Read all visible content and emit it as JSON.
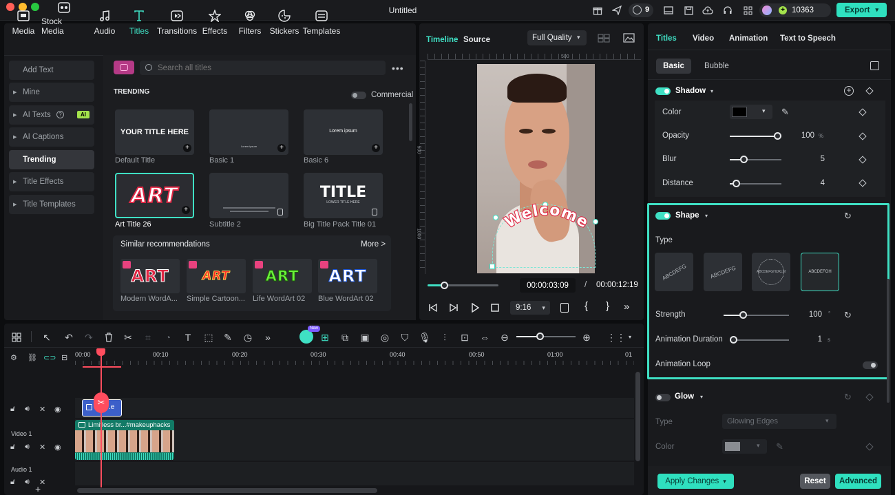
{
  "window": {
    "title": "Untitled"
  },
  "titlebar": {
    "notifications_count": "9",
    "credits": "10363",
    "export_label": "Export"
  },
  "media_tabs": [
    {
      "label": "Media",
      "icon": "media-icon"
    },
    {
      "label": "Stock Media",
      "icon": "stock-media-icon"
    },
    {
      "label": "Audio",
      "icon": "music-note-icon"
    },
    {
      "label": "Titles",
      "icon": "text-t-icon"
    },
    {
      "label": "Transitions",
      "icon": "transitions-icon"
    },
    {
      "label": "Effects",
      "icon": "effects-icon"
    },
    {
      "label": "Filters",
      "icon": "filters-icon"
    },
    {
      "label": "Stickers",
      "icon": "stickers-icon"
    },
    {
      "label": "Templates",
      "icon": "templates-icon"
    }
  ],
  "titles_sidebar": [
    "Add Text",
    "Mine",
    "AI Texts",
    "AI Captions",
    "Trending",
    "Title Effects",
    "Title Templates"
  ],
  "ai_badge": "AI",
  "search": {
    "placeholder": "Search all titles"
  },
  "browser": {
    "section_title": "TRENDING",
    "commercial_label": "Commercial",
    "cards": [
      {
        "label": "Default Title",
        "preview_text": "YOUR TITLE HERE"
      },
      {
        "label": "Basic 1",
        "preview_text": "Lorem ipsum"
      },
      {
        "label": "Basic 6",
        "preview_text": "Lorem ipsum"
      },
      {
        "label": "Art Title 26",
        "preview_text": "ART"
      },
      {
        "label": "Subtitle 2",
        "preview_text": ""
      },
      {
        "label": "Big Title Pack Title 01",
        "preview_text": "TITLE",
        "preview_sub": "LOWER TITLE HERE"
      }
    ],
    "similar_title": "Similar recommendations",
    "more_label": "More >",
    "recommendations": [
      {
        "label": "Modern WordA...",
        "preview_text": "ART"
      },
      {
        "label": "Simple Cartoon...",
        "preview_text": "ART"
      },
      {
        "label": "Life WordArt 02",
        "preview_text": "ART"
      },
      {
        "label": "Blue WordArt 02",
        "preview_text": "ART"
      }
    ]
  },
  "player": {
    "tab_timeline": "Timeline",
    "tab_source": "Source",
    "quality": "Full Quality",
    "ruler_500": "500",
    "ruler_left_1": "500",
    "ruler_left_2": "1000",
    "overlay_text": "Welcome",
    "current_time": "00:00:03:09",
    "separator": "/",
    "total_time": "00:00:12:19",
    "aspect": "9:16",
    "progress": 0.23
  },
  "timeline": {
    "ai_badge": "New",
    "ticks": [
      "00:00",
      "00:10",
      "00:20",
      "00:30",
      "00:40",
      "00:50",
      "01:00",
      "01"
    ],
    "title_clip_label": ".e",
    "video_clip_label": "Limitless br...#makeuphacks",
    "track_video": "Video 1",
    "track_audio": "Audio 1"
  },
  "properties": {
    "tabs": [
      "Titles",
      "Video",
      "Animation",
      "Text to Speech"
    ],
    "subtabs": [
      "Basic",
      "Bubble"
    ],
    "shadow": {
      "title": "Shadow",
      "color_label": "Color",
      "opacity_label": "Opacity",
      "opacity_value": "100",
      "opacity_unit": "%",
      "blur_label": "Blur",
      "blur_value": "5",
      "distance_label": "Distance",
      "distance_value": "4"
    },
    "shape": {
      "title": "Shape",
      "type_label": "Type",
      "types": [
        "ABCDEFG",
        "ABCDEFG",
        "ABCDEFGHIJKLM",
        "ABCDEFGH"
      ],
      "strength_label": "Strength",
      "strength_value": "100",
      "strength_unit": "°",
      "duration_label": "Animation Duration",
      "duration_value": "1",
      "duration_unit": "s",
      "loop_label": "Animation Loop"
    },
    "glow": {
      "title": "Glow",
      "type_label": "Type",
      "type_value": "Glowing Edges",
      "color_label": "Color"
    },
    "footer": {
      "apply": "Apply Changes",
      "reset": "Reset",
      "advanced": "Advanced"
    }
  },
  "colors": {
    "accent": "#3fe0c4",
    "highlight_border": "#3fe0c4",
    "playhead": "#ff4d5e"
  }
}
